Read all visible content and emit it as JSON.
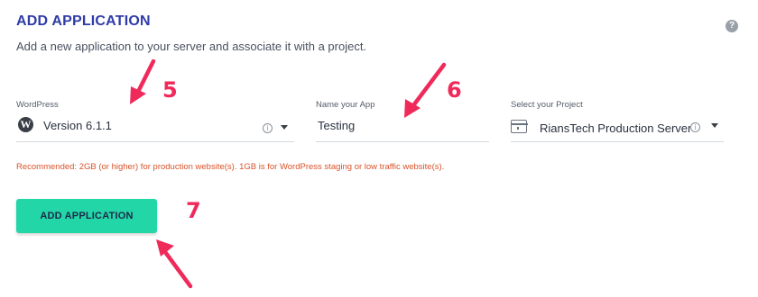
{
  "page": {
    "title": "ADD APPLICATION",
    "subtitle": "Add a new application to your server and associate it with a project."
  },
  "fields": {
    "wordpress": {
      "label": "WordPress",
      "value": "Version 6.1.1"
    },
    "app_name": {
      "label": "Name your App",
      "value": "Testing"
    },
    "project": {
      "label": "Select your Project",
      "value": "RiansTech Production Server"
    }
  },
  "recommendation": "Recommended: 2GB (or higher) for production website(s). 1GB is for WordPress staging or low traffic website(s).",
  "add_button": {
    "label": "ADD APPLICATION"
  },
  "annotations": {
    "step_5": "5",
    "step_6": "6",
    "step_7": "7",
    "color": "#ef2a5a"
  },
  "icons": [
    "help-icon",
    "wordpress-icon",
    "info-icon",
    "chevron-down-icon",
    "project-folder-icon"
  ],
  "colors": {
    "accent": "#23d6a8",
    "title": "#2f3ba8",
    "warning": "#d9522a"
  }
}
